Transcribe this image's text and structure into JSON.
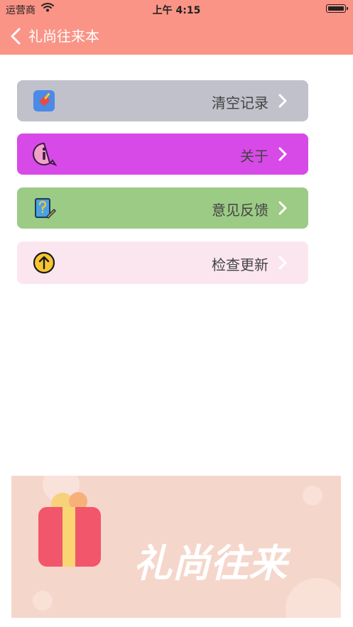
{
  "status_bar": {
    "carrier": "运营商",
    "time": "上午 4:15"
  },
  "nav": {
    "title": "礼尚往来本"
  },
  "menu": [
    {
      "label": "清空记录",
      "icon": "broom-icon",
      "color": "#c0c1cb"
    },
    {
      "label": "关于",
      "icon": "info-icon",
      "color": "#d84ae8"
    },
    {
      "label": "意见反馈",
      "icon": "feedback-icon",
      "color": "#9ccb85"
    },
    {
      "label": "检查更新",
      "icon": "upload-icon",
      "color": "#fbe6ef"
    }
  ],
  "banner": {
    "text": "礼尚往来"
  },
  "colors": {
    "header": "#fa9486",
    "banner_bg": "#f5d6cb",
    "gift": "#f2566a"
  }
}
